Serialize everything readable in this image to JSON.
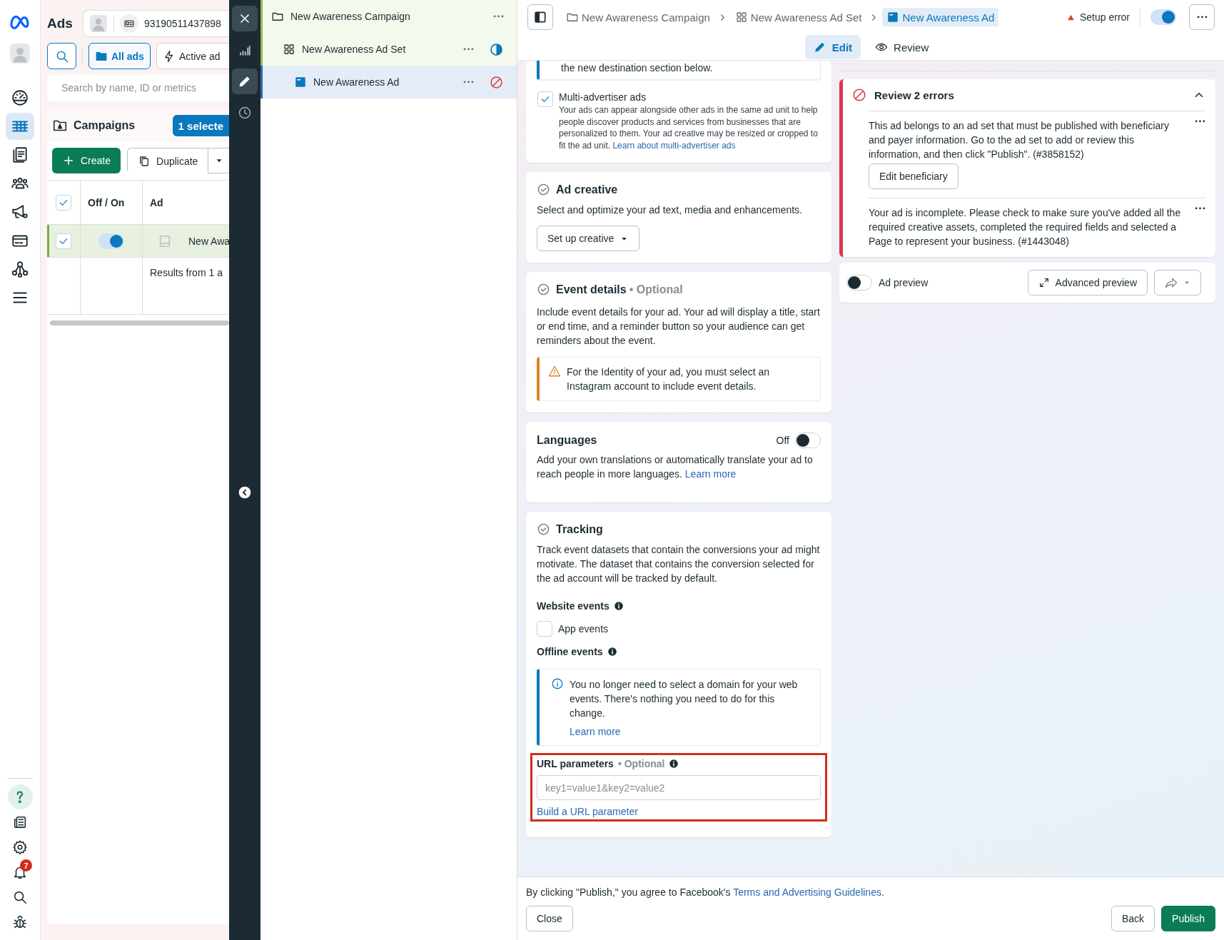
{
  "nav_rail": {
    "items": [
      {
        "kind": "dashboard",
        "selected": false
      },
      {
        "kind": "table",
        "selected": true
      },
      {
        "kind": "documents",
        "selected": false
      },
      {
        "kind": "people",
        "selected": false
      },
      {
        "kind": "megaphone",
        "selected": false
      },
      {
        "kind": "card",
        "selected": false
      },
      {
        "kind": "network",
        "selected": false
      },
      {
        "kind": "menu",
        "selected": false
      }
    ],
    "bottom_items": [
      {
        "kind": "help"
      },
      {
        "kind": "news"
      },
      {
        "kind": "settings"
      },
      {
        "kind": "notifications",
        "badge": "7"
      },
      {
        "kind": "search"
      },
      {
        "kind": "bug"
      }
    ]
  },
  "ads_panel": {
    "title": "Ads",
    "account_id": "93190511437898",
    "filters": [
      {
        "label": "All ads",
        "selected": true
      },
      {
        "label": "Active ad",
        "selected": false
      }
    ],
    "search": {
      "placeholder": "Search by name, ID or metrics"
    },
    "section_title": "Campaigns",
    "selection_badge": "1 selecte",
    "create_button": "Create",
    "duplicate_button": "Duplicate",
    "table": {
      "header_checked": true,
      "columns": [
        "Off / On",
        "Ad"
      ],
      "rows": [
        {
          "checked": true,
          "on": true,
          "name": "New Awa"
        }
      ],
      "footer": "Results from 1 a"
    }
  },
  "tool_strip": {
    "items": [
      {
        "kind": "close"
      },
      {
        "kind": "chart",
        "selected": false
      },
      {
        "kind": "edit",
        "selected": true
      },
      {
        "kind": "history",
        "selected": false
      }
    ]
  },
  "tree": [
    {
      "kind": "campaign",
      "name": "New Awareness Campaign",
      "selected": false,
      "children": [
        {
          "kind": "ad_set",
          "name": "New Awareness Ad Set",
          "status": {
            "kind": "partial"
          },
          "selected": false,
          "children": [
            {
              "kind": "ad",
              "name": "New Awareness Ad",
              "status": {
                "kind": "error"
              },
              "selected": true
            }
          ]
        }
      ]
    }
  ],
  "editor": {
    "breadcrumb": [
      {
        "kind": "campaign",
        "label": "New Awareness Campaign",
        "selected": false
      },
      {
        "kind": "ad_set",
        "label": "New Awareness Ad Set",
        "selected": false
      },
      {
        "kind": "ad",
        "label": "New Awareness Ad",
        "selected": true
      }
    ],
    "status": "Setup error",
    "on": true,
    "tabs": [
      {
        "kind": "edit",
        "label": "Edit",
        "selected": true
      },
      {
        "kind": "review",
        "label": "Review",
        "selected": false
      }
    ]
  },
  "form": {
    "destination_note": "the new destination section below.",
    "multi_advertiser": {
      "checked": true,
      "title": "Multi-advertiser ads",
      "body": "Your ads can appear alongside other ads in the same ad unit to help people discover products and services from businesses that are personalized to them. Your ad creative may be resized or cropped to fit the ad unit.",
      "link": "Learn about multi-advertiser ads"
    },
    "ad_creative": {
      "title": "Ad creative",
      "description": "Select and optimize your ad text, media and enhancements.",
      "button": "Set up creative"
    },
    "event_details": {
      "title": "Event details",
      "optional": "• Optional",
      "description": "Include event details for your ad. Your ad will display a title, start or end time, and a reminder button so your audience can get reminders about the event.",
      "warning": "For the Identity of your ad, you must select an Instagram account to include event details."
    },
    "languages": {
      "title": "Languages",
      "toggle_label": "Off",
      "on": false,
      "description": "Add your own translations or automatically translate your ad to reach people in more languages.",
      "link": "Learn more"
    },
    "tracking": {
      "title": "Tracking",
      "description": "Track event datasets that contain the conversions your ad might motivate. The dataset that contains the conversion selected for the ad account will be tracked by default.",
      "website_events": "Website events",
      "app_events": {
        "label": "App events",
        "checked": false
      },
      "offline_events": "Offline events",
      "notice": "You no longer need to select a domain for your web events. There's nothing you need to do for this change.",
      "notice_link": "Learn more",
      "url_parameters": {
        "label": "URL parameters",
        "optional": "• Optional",
        "placeholder": "key1=value1&key2=value2",
        "link": "Build a URL parameter",
        "highlighted": true
      }
    }
  },
  "review": {
    "errors_title": "Review 2 errors",
    "expanded": true,
    "errors": [
      {
        "text": "This ad belongs to an ad set that must be published with beneficiary and payer information. Go to the ad set to add or review this information, and then click \"Publish\". (#3858152)",
        "button": "Edit beneficiary"
      },
      {
        "text": "Your ad is incomplete. Please check to make sure you've added all the required creative assets, completed the required fields and selected a Page to represent your business. (#1443048)"
      }
    ],
    "preview": {
      "label": "Ad preview",
      "on": false,
      "advanced_button": "Advanced preview"
    }
  },
  "footer": {
    "terms_text": "By clicking \"Publish,\" you agree to Facebook's",
    "terms_link": "Terms and Advertising Guidelines",
    "terms_end": ".",
    "buttons": [
      {
        "kind": "close",
        "label": "Close"
      },
      {
        "kind": "back",
        "label": "Back"
      },
      {
        "kind": "publish",
        "label": "Publish"
      }
    ]
  }
}
